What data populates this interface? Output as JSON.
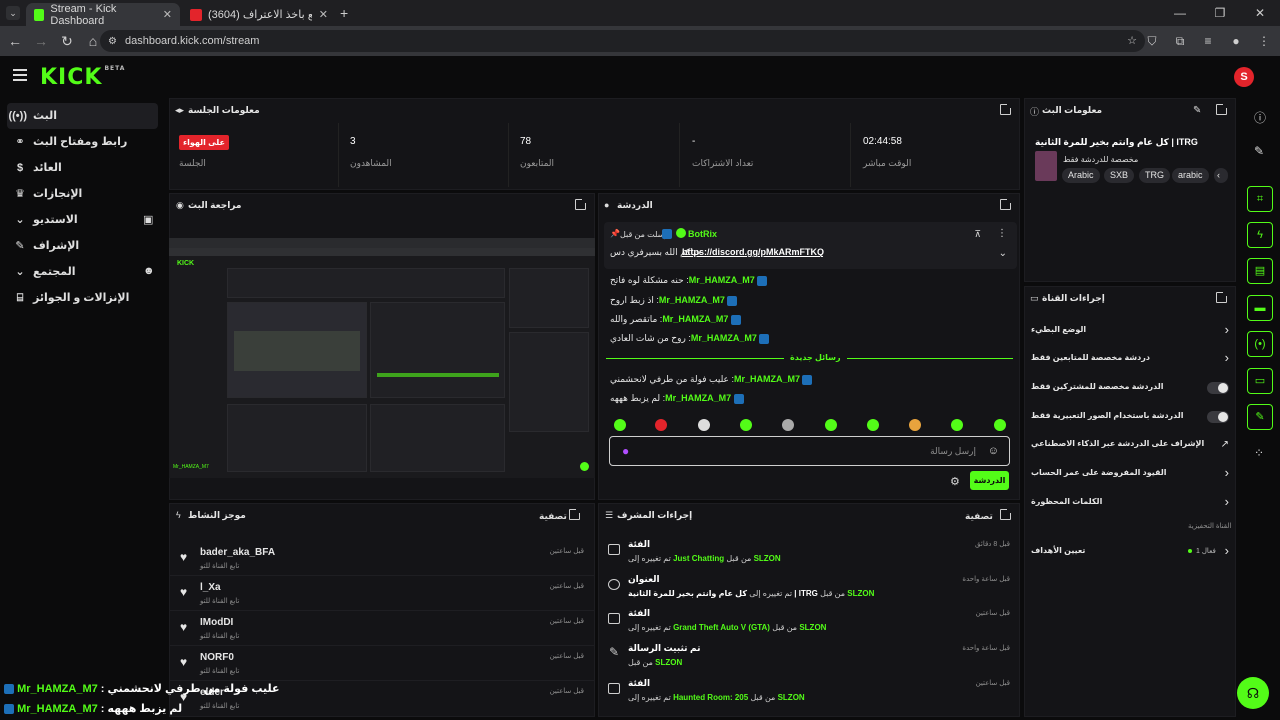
{
  "browser": {
    "tabs": [
      {
        "title": "Stream - Kick Dashboard"
      },
      {
        "title": "(3604) اكثر واحد مقنع باخذ الاعتراف"
      }
    ],
    "url": "dashboard.kick.com/stream"
  },
  "nav": {
    "items": [
      {
        "label": "البث",
        "icon": "broadcast-icon"
      },
      {
        "label": "رابط ومفتاح البث",
        "icon": "link-icon"
      },
      {
        "label": "العائد",
        "icon": "money-icon"
      },
      {
        "label": "الإنجازات",
        "icon": "trophy-icon"
      },
      {
        "label": "الاستديو",
        "icon": "studio-icon"
      },
      {
        "label": "الإشراف",
        "icon": "wrench-icon"
      },
      {
        "label": "المجتمع",
        "icon": "community-icon"
      },
      {
        "label": "الإنزالات و الجوائز",
        "icon": "gift-icon"
      }
    ]
  },
  "session": {
    "title": "معلومات الجلسة",
    "live_badge": "على الهواء",
    "live_label": "الجلسة",
    "viewers": "3",
    "viewers_label": "المشاهدون",
    "followers": "78",
    "followers_label": "المتابعون",
    "subs": "-",
    "subs_label": "تعداد الاشتراكات",
    "uptime": "02:44:58",
    "uptime_label": "الوقت مباشر"
  },
  "preview": {
    "title": "مراجعة البث"
  },
  "chat": {
    "title": "الدردشة",
    "pinned_by": "أرسلت من قبل",
    "pinned_user": "BotRix",
    "pinned_text": "حياكم الله بسيرفري دس",
    "pinned_link": "https://discord.gg/pMkARmFTKQ",
    "messages": [
      {
        "user": "Mr_HAMZA_M7",
        "text": "حنه مشكلة لوه فاتح"
      },
      {
        "user": "Mr_HAMZA_M7",
        "text": "اذ زبط اروح"
      },
      {
        "user": "Mr_HAMZA_M7",
        "text": "ماتقصر والله"
      },
      {
        "user": "Mr_HAMZA_M7",
        "text": "روح من شات العادي"
      },
      {
        "user": "Mr_HAMZA_M7",
        "text": "عليب فولة من طرفي لانحشمني"
      },
      {
        "user": "Mr_HAMZA_M7",
        "text": "لم يزبط هههه"
      }
    ],
    "new_messages_label": "رسائل جديدة",
    "input_placeholder": "إرسل رسالة",
    "send_label": "الدردشة"
  },
  "activity": {
    "title": "موجز النشاط",
    "filter_label": "تصفية",
    "items": [
      {
        "user": "bader_aka_BFA",
        "sub": "تابع القناة للتو",
        "time": "قبل ساعتين"
      },
      {
        "user": "l_Xa",
        "sub": "تابع القناة للتو",
        "time": "قبل ساعتين"
      },
      {
        "user": "IModDI",
        "sub": "تابع القناة للتو",
        "time": "قبل ساعتين"
      },
      {
        "user": "NORF0",
        "sub": "تابع القناة للتو",
        "time": "قبل ساعتين"
      },
      {
        "user": "elder",
        "sub": "تابع القناة للتو",
        "time": "قبل ساعتين"
      }
    ]
  },
  "mod_actions": {
    "title": "إجراءات المشرف",
    "filter_label": "تصفية",
    "items": [
      {
        "title": "الفئة",
        "pre": "تم تغييره إلى",
        "value": "Just Chatting",
        "by": "من قبل",
        "user": "SLZON",
        "time": "قبل 8 دقائق"
      },
      {
        "title": "العنوان",
        "pre": "تم تغييره إلى",
        "value": "كل عام وانتم بخير للمرة الثانية | ITRG",
        "by": "من قبل",
        "user": "SLZON",
        "time": "قبل ساعة واحدة"
      },
      {
        "title": "الفئة",
        "pre": "تم تغييره إلى",
        "value": "Grand Theft Auto V (GTA)",
        "by": "من قبل",
        "user": "SLZON",
        "time": "قبل ساعتين"
      },
      {
        "title": "تم تثبيت الرسالة",
        "pre": "من قبل",
        "value": "",
        "by": "",
        "user": "SLZON",
        "time": "قبل ساعة واحدة"
      },
      {
        "title": "الفئة",
        "pre": "تم تغييره إلى",
        "value": "Haunted Room: 205",
        "by": "من قبل",
        "user": "SLZON",
        "time": "قبل ساعتين"
      }
    ]
  },
  "stream_info": {
    "title": "معلومات البث",
    "stream_title": "كل عام وانتم بخير للمرة الثانية | ITRG",
    "subtitle": "مخصصة للدردشة فقط",
    "tags": [
      "Arabic",
      "SXB",
      "TRG",
      "arabic"
    ]
  },
  "channel_actions": {
    "title": "إجراءات القناة",
    "rows": [
      {
        "label": "الوضع البطيء",
        "control": "chevron"
      },
      {
        "label": "دردشة مخصصة للمتابعين فقط",
        "control": "chevron"
      },
      {
        "label": "الدردشة مخصصة للمشتركين فقط",
        "control": "toggle"
      },
      {
        "label": "الدردشة باستخدام الصور التعبيرية فقط",
        "control": "toggle"
      },
      {
        "label": "الإشراف على الدردشة عبر الذكاء الاصطناعي",
        "control": "external"
      },
      {
        "label": "القيود المفروضة على عمر الحساب",
        "control": "chevron"
      },
      {
        "label": "الكلمات المحظورة",
        "control": "chevron"
      }
    ],
    "promo_section": "القناة التحفيزية",
    "goals_label": "تعيين الأهداف",
    "goals_value": "فعال 1"
  },
  "bottom_overlay": [
    {
      "user": "Mr_HAMZA_M7",
      "text": "عليب فولة من طرفي لانحشمني"
    },
    {
      "user": "Mr_HAMZA_M7",
      "text": "لم يزبط هههه"
    }
  ],
  "colors": {
    "accent": "#53fc18",
    "live": "#e3242b",
    "bg": "#0b0b0c",
    "panel": "#141417"
  }
}
